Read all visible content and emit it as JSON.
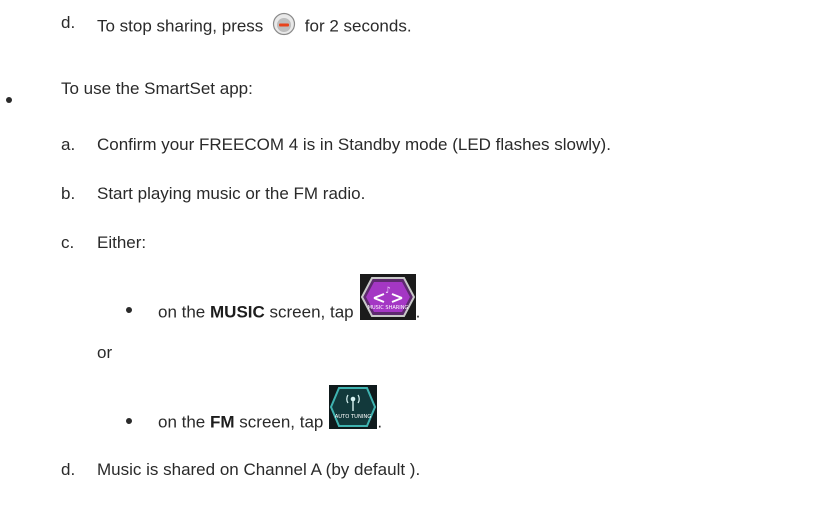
{
  "step_d_stop": {
    "marker": "d.",
    "text_before": "To stop sharing, press",
    "icon": "minus-button-icon",
    "text_after": "for 2 seconds."
  },
  "smartset_intro": "To use the SmartSet app:",
  "steps": [
    {
      "marker": "a.",
      "text": "Confirm your FREECOM 4 is in Standby mode (LED flashes slowly)."
    },
    {
      "marker": "b.",
      "text": "Start playing music or the FM radio."
    },
    {
      "marker": "c.",
      "text": "Either:"
    }
  ],
  "music_option": {
    "text_before": "on the",
    "screen_name": "MUSIC",
    "text_after": "screen, tap",
    "button_label": "MUSIC SHARING",
    "period": "."
  },
  "or_text": "or",
  "fm_option": {
    "text_before": "on the",
    "screen_name": "FM",
    "text_after": "screen, tap",
    "button_label": "AUTO TUNING",
    "period": "."
  },
  "step_d_final": {
    "marker": "d.",
    "text": "Music is shared on Channel A (by default )."
  }
}
